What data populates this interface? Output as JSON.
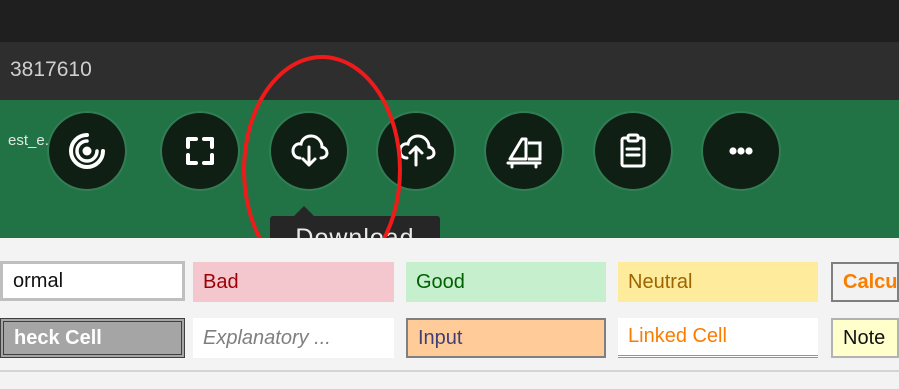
{
  "browser": {
    "url_fragment": "3817610"
  },
  "ribbon": {
    "doc_title_fragment": "est_e... - Excel"
  },
  "toolbar": {
    "buttons": [
      {
        "name": "loading-ring-icon"
      },
      {
        "name": "fullscreen-icon"
      },
      {
        "name": "download-icon"
      },
      {
        "name": "upload-icon"
      },
      {
        "name": "present-icon"
      },
      {
        "name": "clipboard-icon"
      },
      {
        "name": "more-icon",
        "label": "..."
      }
    ],
    "tooltip": "Download"
  },
  "cell_styles": {
    "row1": [
      "ormal",
      "Bad",
      "Good",
      "Neutral",
      "Calcu"
    ],
    "row2": [
      "heck Cell",
      "Explanatory ...",
      "Input",
      "Linked Cell",
      "Note"
    ]
  },
  "colors": {
    "ribbon_green": "#217346",
    "bad_bg": "#f4c7ce",
    "good_bg": "#c6efce",
    "neutral_bg": "#ffeb9c",
    "input_bg": "#ffcc99",
    "highlight_red": "#ef1b1b"
  }
}
